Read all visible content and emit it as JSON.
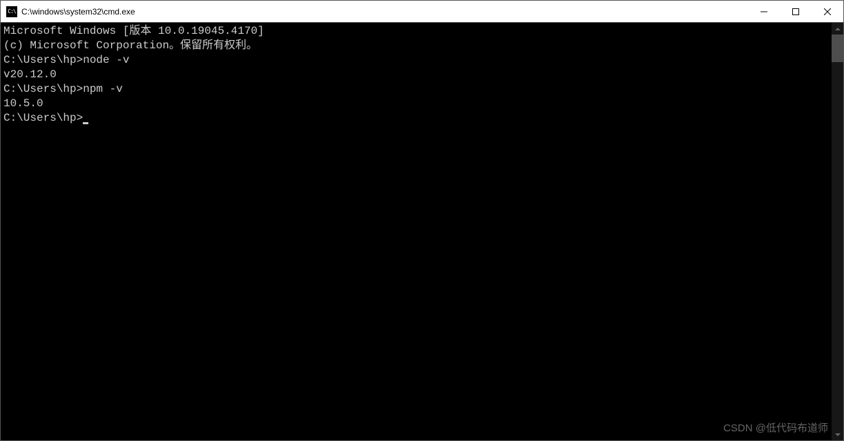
{
  "titlebar": {
    "icon_text": "C:\\",
    "title": "C:\\windows\\system32\\cmd.exe"
  },
  "terminal": {
    "header_line1": "Microsoft Windows [版本 10.0.19045.4170]",
    "header_line2": "(c) Microsoft Corporation。保留所有权利。",
    "blocks": [
      {
        "prompt": "C:\\Users\\hp>",
        "command": "node -v",
        "output": "v20.12.0"
      },
      {
        "prompt": "C:\\Users\\hp>",
        "command": "npm -v",
        "output": "10.5.0"
      }
    ],
    "current_prompt": "C:\\Users\\hp>"
  },
  "watermark": "CSDN @低代码布道师"
}
